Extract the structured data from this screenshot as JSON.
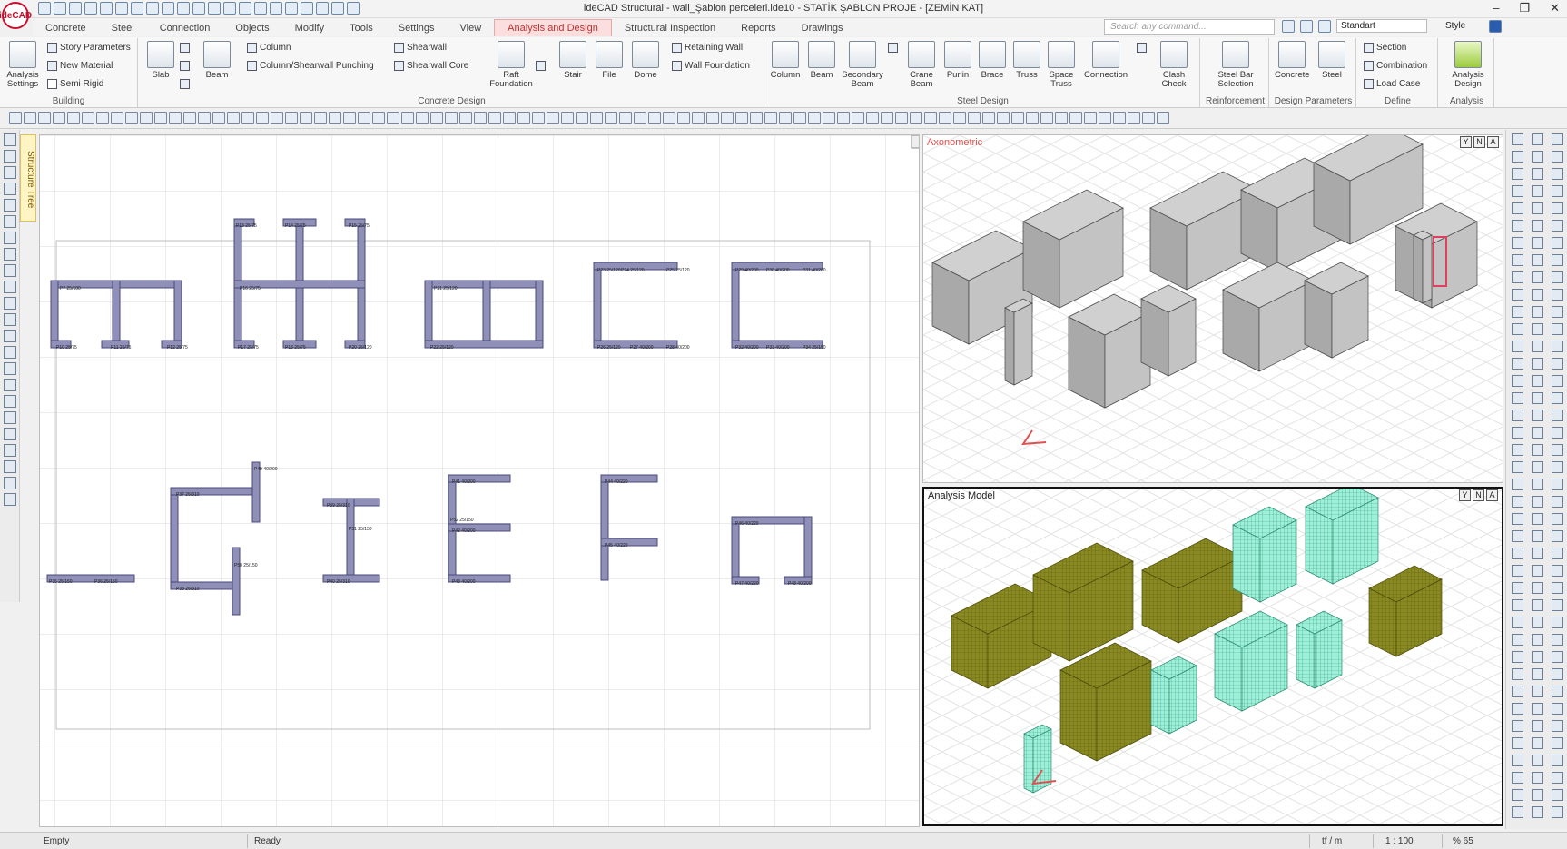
{
  "app": {
    "logo": "ideCAD",
    "window_title": "ideCAD Structural - wall_Şablon perceleri.ide10 - STATİK ŞABLON PROJE - [ZEMİN KAT]"
  },
  "menu": {
    "tabs": [
      "Concrete",
      "Steel",
      "Connection",
      "Objects",
      "Modify",
      "Tools",
      "Settings",
      "View",
      "Analysis and Design",
      "Structural Inspection",
      "Reports",
      "Drawings"
    ],
    "active_tab": "Analysis and Design"
  },
  "search": {
    "placeholder": "Search any command..."
  },
  "style_selector": {
    "value": "Standart",
    "label": "Style"
  },
  "ribbon": {
    "building": {
      "group_label": "Building",
      "analysis_settings": "Analysis Settings",
      "story_parameters": "Story Parameters",
      "new_material": "New Material",
      "semi_rigid": "Semi Rigid"
    },
    "concrete_design": {
      "group_label": "Concrete Design",
      "slab": "Slab",
      "beam": "Beam",
      "column": "Column",
      "column_shearwall_punching": "Column/Shearwall Punching",
      "shearwall": "Shearwall",
      "shearwall_core": "Shearwall Core",
      "raft_foundation": "Raft Foundation",
      "stair": "Stair",
      "file": "File",
      "dome": "Dome",
      "retaining_wall": "Retaining Wall",
      "wall_foundation": "Wall Foundation"
    },
    "steel_design": {
      "group_label": "Steel Design",
      "column": "Column",
      "beam": "Beam",
      "secondary_beam": "Secondary Beam",
      "crane_beam": "Crane Beam",
      "purlin": "Purlin",
      "brace": "Brace",
      "truss": "Truss",
      "space_truss": "Space Truss",
      "connection": "Connection",
      "clash_check": "Clash Check"
    },
    "reinforcement": {
      "group_label": "Reinforcement",
      "steel_bar_selection": "Steel Bar Selection"
    },
    "design_parameters": {
      "group_label": "Design Parameters",
      "concrete": "Concrete",
      "steel": "Steel"
    },
    "define": {
      "group_label": "Define",
      "section": "Section",
      "combination": "Combination",
      "load_case": "Load Case"
    },
    "analysis": {
      "group_label": "Analysis",
      "analysis_design": "Analysis Design"
    }
  },
  "side_panel": {
    "structure_tree": "Structure Tree"
  },
  "viewports": {
    "axonometric": "Axonometric",
    "analysis_model": "Analysis Model",
    "view_buttons": [
      "Y",
      "N",
      "A"
    ]
  },
  "plan_labels": [
    "P7 25/100",
    "P10 25/75",
    "P11 25/75",
    "P12 25/75",
    "P13 25/75",
    "P14 25/75",
    "P15 25/75",
    "P16 25/75",
    "P17 25/75",
    "P18 25/75",
    "P20 25/120",
    "P21 25/120",
    "P22 25/120",
    "P23 25/120",
    "P24 25/120",
    "P25 25/120",
    "P26 25/120",
    "P27 40/200",
    "P28 40/200",
    "P29 40/200",
    "P30 40/200",
    "P31 40/200",
    "P32 40/200",
    "P33 40/200",
    "P34 25/150",
    "P35 25/150",
    "P36 25/150",
    "P37 25/310",
    "P38 25/310",
    "P39 25/310",
    "P40 25/310",
    "P41 40/200",
    "P42 40/200",
    "P43 40/200",
    "P44 40/220",
    "P45 40/220",
    "P46 40/220",
    "P47 40/220",
    "P48 40/200",
    "P49 40/200",
    "P50 25/150",
    "P51 25/150",
    "P52 25/150"
  ],
  "status": {
    "left": "Empty",
    "message": "Ready",
    "units": "tf / m",
    "scale": "1 : 100",
    "zoom": "% 65"
  },
  "colors": {
    "wall_fill": "#8f8fb8",
    "wall_stroke": "#4a4a7a",
    "mesh_olive": "#8a8a22",
    "mesh_cyan": "#88e0c8",
    "accent": "#c8102e"
  }
}
